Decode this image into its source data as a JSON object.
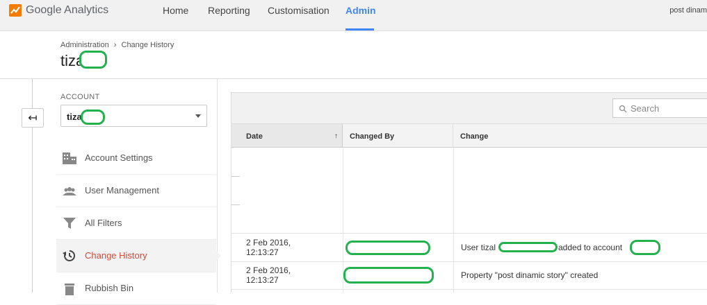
{
  "app": {
    "logo_text": "Google Analytics",
    "account_label": "post dinam"
  },
  "nav": {
    "home": "Home",
    "reporting": "Reporting",
    "customisation": "Customisation",
    "admin": "Admin"
  },
  "header": {
    "breadcrumb_root": "Administration",
    "breadcrumb_sep": "›",
    "breadcrumb_current": "Change History",
    "title": "tiza"
  },
  "sidebar": {
    "back_icon": "↤",
    "account_section_label": "ACCOUNT",
    "account_selected": "tiza",
    "items": [
      {
        "label": "Account Settings",
        "icon": "building-icon"
      },
      {
        "label": "User Management",
        "icon": "users-icon"
      },
      {
        "label": "All Filters",
        "icon": "filter-icon"
      },
      {
        "label": "Change History",
        "icon": "history-icon"
      },
      {
        "label": "Rubbish Bin",
        "icon": "trash-icon"
      }
    ]
  },
  "search": {
    "placeholder": "Search"
  },
  "table": {
    "columns": {
      "date": "Date",
      "changed_by": "Changed By",
      "change": "Change"
    },
    "sort_indicator": "↑",
    "rows": [
      {
        "date_line1": "2 Feb 2016,",
        "date_line2": "12:13:27",
        "change_part1": "User tizal",
        "change_part2": "added to account"
      },
      {
        "date_line1": "2 Feb 2016,",
        "date_line2": "12:13:27",
        "change": "Property \"post dinamic story\" created"
      }
    ]
  },
  "colors": {
    "accent": "#4285f4",
    "active_menu": "#d34836",
    "redaction": "#22b14c"
  }
}
